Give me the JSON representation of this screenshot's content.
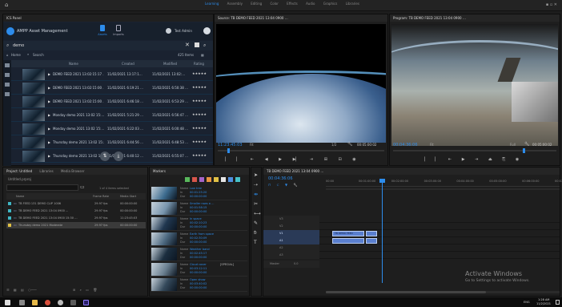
{
  "menu": {
    "items": [
      "Learning",
      "Assembly",
      "Editing",
      "Color",
      "Effects",
      "Audio",
      "Graphics",
      "Libraries"
    ],
    "active_index": 0
  },
  "ams": {
    "tab_label": "ICS Panel",
    "title": "AMPP Asset Management",
    "nav_assets": "Assets",
    "nav_ingest": "Imports",
    "user": "Test Admin",
    "search_value": "demo",
    "breadcrumb_home": "Home",
    "breadcrumb_search": "Search",
    "result_count": "425 Items",
    "columns": [
      "Name",
      "Created",
      "Modified",
      "Rating"
    ],
    "assets": [
      {
        "name": "DEMO FEED 2021 13:02:15:17 …",
        "created": "11/02/2021 13:17:1…",
        "modified": "11/02/2021 13:02:…",
        "stars": "★★★★★"
      },
      {
        "name": "DEMO FEED 2021 13:02:15:00 …",
        "created": "11/02/2021 6:19:21 …",
        "modified": "11/02/2021 6:50:38 …",
        "stars": "★★★★★"
      },
      {
        "name": "DEMO FEED 2021 13:02:15:00 …",
        "created": "11/02/2021 6:46:18 …",
        "modified": "11/02/2021 6:53:29 …",
        "stars": "★★★★★"
      },
      {
        "name": "Monday demo 2021 13:02 15:…",
        "created": "11/02/2021 5:21:29 …",
        "modified": "11/02/2021 6:56:47 …",
        "stars": "★★★★★"
      },
      {
        "name": "Monday demo 2021 13:02 15:…",
        "created": "11/02/2021 6:22:03 …",
        "modified": "11/02/2021 6:00:48 …",
        "stars": "★★★★★"
      },
      {
        "name": "Thursday demo 2021 13:02 15:…",
        "created": "11/02/2021 6:44:56 …",
        "modified": "11/02/2021 6:48:53 …",
        "stars": "★★★★★"
      },
      {
        "name": "Thursday demo 2021 13:02 15:…",
        "created": "11/02/2021 6:40:12 …",
        "modified": "11/02/2021 6:55:07 …",
        "stars": "★★★★★"
      }
    ]
  },
  "source_monitor": {
    "tab_label": "Source: TB DEMO FEED 2021 13:04 0900 …",
    "timecode": "11:23:45:03",
    "fit": "Fit",
    "scale": "1/2",
    "duration": "00:05:00:02"
  },
  "program_monitor": {
    "tab_label": "Program: TB DEMO FEED 2021 13:04 0900 …",
    "timecode": "00:04:36:06",
    "fit": "Fit",
    "scale": "Full",
    "duration": "00:05:00:02"
  },
  "project": {
    "tabs": [
      "Project: Untitled",
      "Libraries",
      "Media Browser"
    ],
    "file_label": "Untitled.prproj",
    "selection_count": "1 of 4 items selected",
    "columns": [
      "Name",
      "Frame Rate",
      "Media Start"
    ],
    "items": [
      {
        "name": "TB FEED 131 DEMO CLIP 1006",
        "rate": "29.97 fps",
        "start": "00:00:00:00",
        "color": "#3fb6c4"
      },
      {
        "name": "TB DEMO FEED 2021 13:04 0900 …",
        "rate": "29.97 fps",
        "start": "00:00:00:00",
        "color": "#3fb6c4"
      },
      {
        "name": "TB DEMO FEED 2021 13:04 0900 15:30 …",
        "rate": "29.97 fps",
        "start": "11:23:45:03",
        "color": "#3fb6c4"
      },
      {
        "name": "Thursday demo 2021 Moderate",
        "rate": "29.97 fps",
        "start": "00:00:00:00",
        "color": "#e0c045"
      }
    ]
  },
  "marker_list": {
    "tab_label": "Markers",
    "label_name": "Name",
    "label_in": "In",
    "label_dur": "Dur",
    "entries": [
      {
        "name": "Low tree",
        "in": "00:01:25:20",
        "dur": "00:00:00:00",
        "comment": ""
      },
      {
        "name": "Smaller rows a …",
        "in": "00:01:58:15",
        "dur": "00:00:00:00",
        "comment": ""
      },
      {
        "name": "In space",
        "in": "00:02:10:23",
        "dur": "00:00:00:00",
        "comment": ""
      },
      {
        "name": "Earth from space",
        "in": "00:02:30:09",
        "dur": "00:00:00:00",
        "comment": ""
      },
      {
        "name": "Weather band",
        "in": "00:02:45:17",
        "dur": "00:00:00:00",
        "comment": ""
      },
      {
        "name": "Cloud cover",
        "in": "00:03:12:11",
        "dur": "00:00:00:00",
        "comment": "[SPECIAL]"
      },
      {
        "name": "Open show",
        "in": "00:03:40:02",
        "dur": "00:00:00:00",
        "comment": ""
      }
    ]
  },
  "timeline": {
    "tab_label": "TB DEMO FEED 2021 13:04 0900 …",
    "timecode": "00:04:36:06",
    "ruler": [
      "00:00",
      "00:01:00:00",
      "00:02:00:00",
      "00:03:00:00",
      "00:04:00:00",
      "00:05:00:00",
      "00:06:00:00",
      "00:07:00:00"
    ],
    "video_tracks": [
      "V3",
      "V2",
      "V1"
    ],
    "audio_tracks": [
      "A1",
      "A2",
      "A3"
    ],
    "clip_label": "TB DEMO FEED",
    "master_label": "Master",
    "master_value": "0.0"
  },
  "watermark": {
    "title": "Activate Windows",
    "subtitle": "Go to Settings to activate Windows."
  },
  "taskbar": {
    "time": "1:28 AM",
    "date": "11/2/2021",
    "lang": "ENG"
  },
  "colors": {
    "accent": "#2d8ceb",
    "clip": "#5a7fcf",
    "marker_yellow": "#e0c045",
    "panel_bg": "#1e1e1e"
  }
}
